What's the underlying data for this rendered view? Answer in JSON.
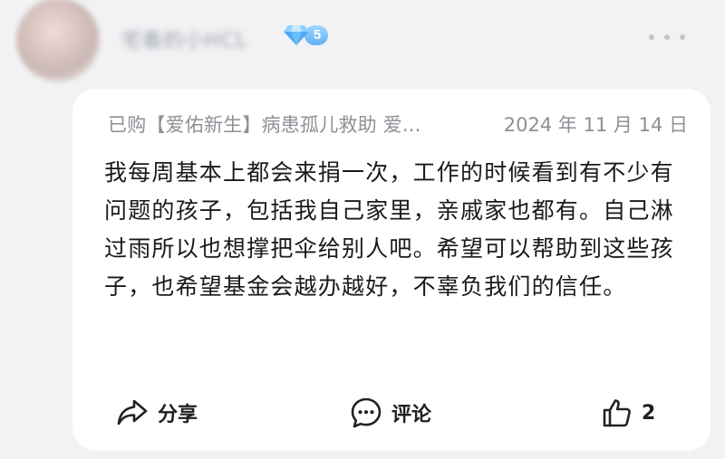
{
  "user": {
    "name": "宅着的小HCL",
    "level": "5"
  },
  "review": {
    "purchase_label": "已购【爱佑新生】病患孤儿救助 爱...",
    "date": "2024 年 11 月 14 日",
    "content": "我每周基本上都会来捐一次，工作的时候看到有不少有问题的孩子，包括我自己家里，亲戚家也都有。自己淋过雨所以也想撑把伞给别人吧。希望可以帮助到这些孩子，也希望基金会越办越好，不辜负我们的信任。"
  },
  "actions": {
    "share_label": "分享",
    "comment_label": "评论",
    "like_count": "2"
  },
  "icons": {
    "share": "share-icon",
    "comment": "comment-bubble-icon",
    "like": "thumbs-up-icon",
    "more": "more-dots-icon",
    "badge": "diamond-icon"
  },
  "colors": {
    "badge_blue": "#5fb0f5",
    "meta_gray": "#8d9096",
    "text": "#1a1a1a"
  }
}
